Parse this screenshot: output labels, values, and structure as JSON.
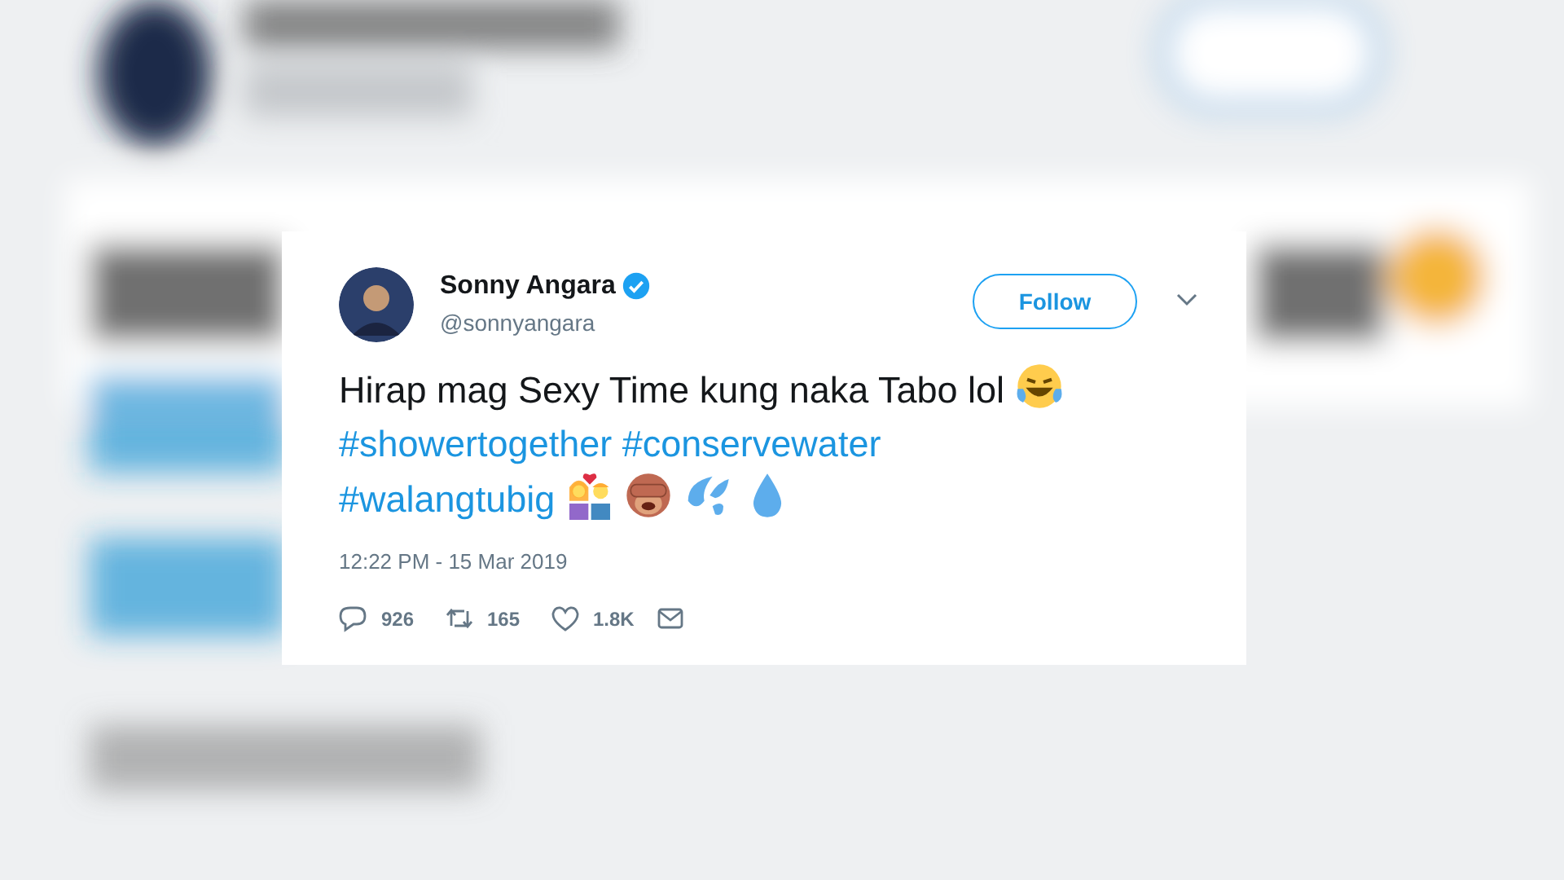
{
  "tweet": {
    "author": {
      "name": "Sonny Angara",
      "verified": true,
      "handle": "@sonnyangara"
    },
    "follow_button": "Follow",
    "text": "Hirap mag Sexy Time kung naka Tabo lol",
    "hashtags": [
      "#showertogether",
      "#conservewater",
      "#walangtubig"
    ],
    "timestamp": "12:22 PM - 15 Mar 2019",
    "actions": [
      {
        "kind": "reply",
        "count": "926"
      },
      {
        "kind": "retweet",
        "count": "165"
      },
      {
        "kind": "like",
        "count": "1.8K"
      },
      {
        "kind": "message"
      }
    ]
  }
}
